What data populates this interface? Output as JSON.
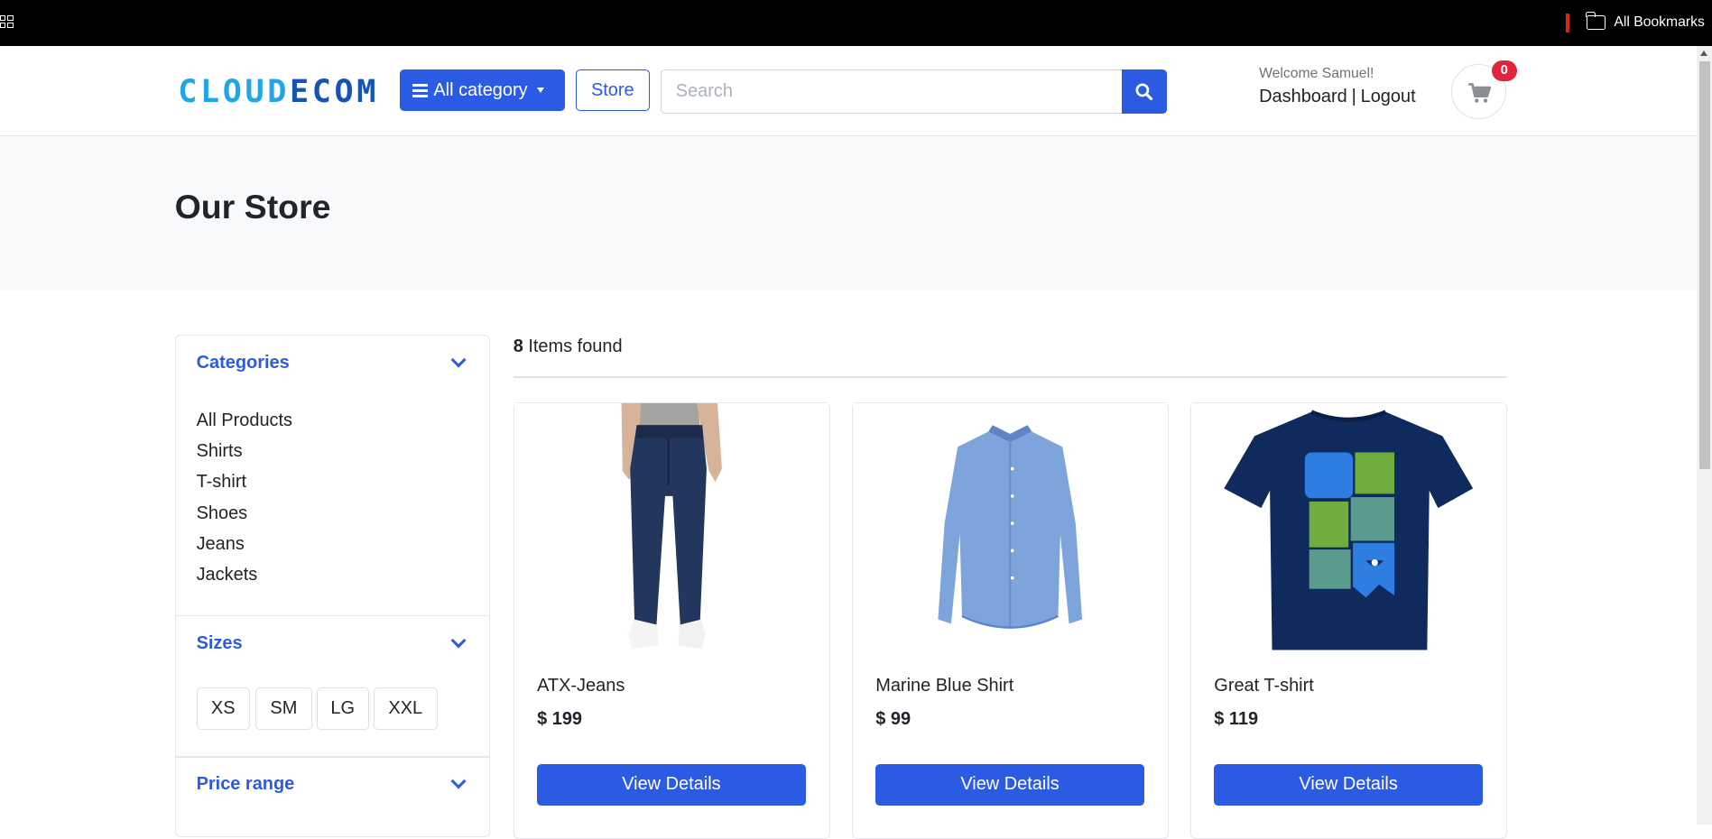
{
  "bookmarks_bar": {
    "all_bookmarks": "All Bookmarks"
  },
  "header": {
    "logo_part1": "CLOUD",
    "logo_part2": "ECOM",
    "category_button": "All category",
    "store_button": "Store",
    "search_placeholder": "Search",
    "welcome": "Welcome Samuel!",
    "dashboard_link": "Dashboard",
    "separator": "|",
    "logout_link": "Logout",
    "cart_count": "0"
  },
  "hero": {
    "title": "Our Store"
  },
  "sidebar": {
    "categories": {
      "title": "Categories",
      "items": [
        "All Products",
        "Shirts",
        "T-shirt",
        "Shoes",
        "Jeans",
        "Jackets"
      ]
    },
    "sizes": {
      "title": "Sizes",
      "items": [
        "XS",
        "SM",
        "LG",
        "XXL"
      ]
    },
    "price_range": {
      "title": "Price range"
    }
  },
  "results": {
    "count": "8",
    "count_label": "Items found"
  },
  "products": [
    {
      "name": "ATX-Jeans",
      "price": "$ 199",
      "button": "View Details",
      "image": "jeans-image"
    },
    {
      "name": "Marine Blue Shirt",
      "price": "$ 99",
      "button": "View Details",
      "image": "shirt-image"
    },
    {
      "name": "Great T-shirt",
      "price": "$ 119",
      "button": "View Details",
      "image": "tshirt-image"
    }
  ],
  "colors": {
    "primary": "#2c5be3",
    "badge": "#e0243a",
    "hero_bg": "#f8f9fa"
  }
}
